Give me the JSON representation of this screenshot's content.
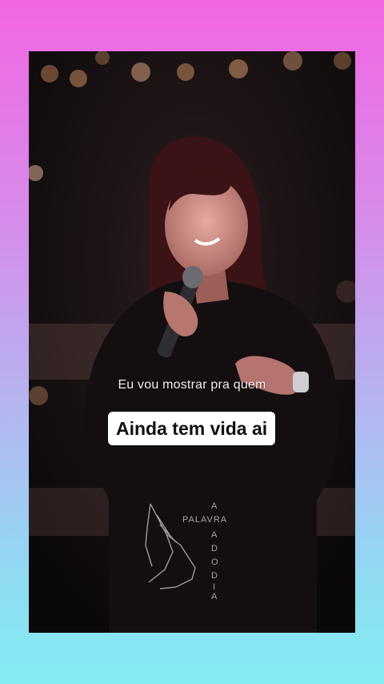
{
  "captions": {
    "line_small": "Eu vou mostrar pra quem",
    "line_main": "Ainda tem vida ai"
  },
  "watermark": {
    "letters_left": "A",
    "word_middle": "PALAVRA",
    "letters_vertical": [
      "D",
      "O",
      "D",
      "I",
      "A"
    ],
    "letter_after_palavra": "A",
    "icon": "praying-hands-icon"
  },
  "colors": {
    "background_top": "#f266e3",
    "background_bottom": "#84ecf3",
    "caption_box": "#ffffff",
    "caption_text": "#111111"
  }
}
